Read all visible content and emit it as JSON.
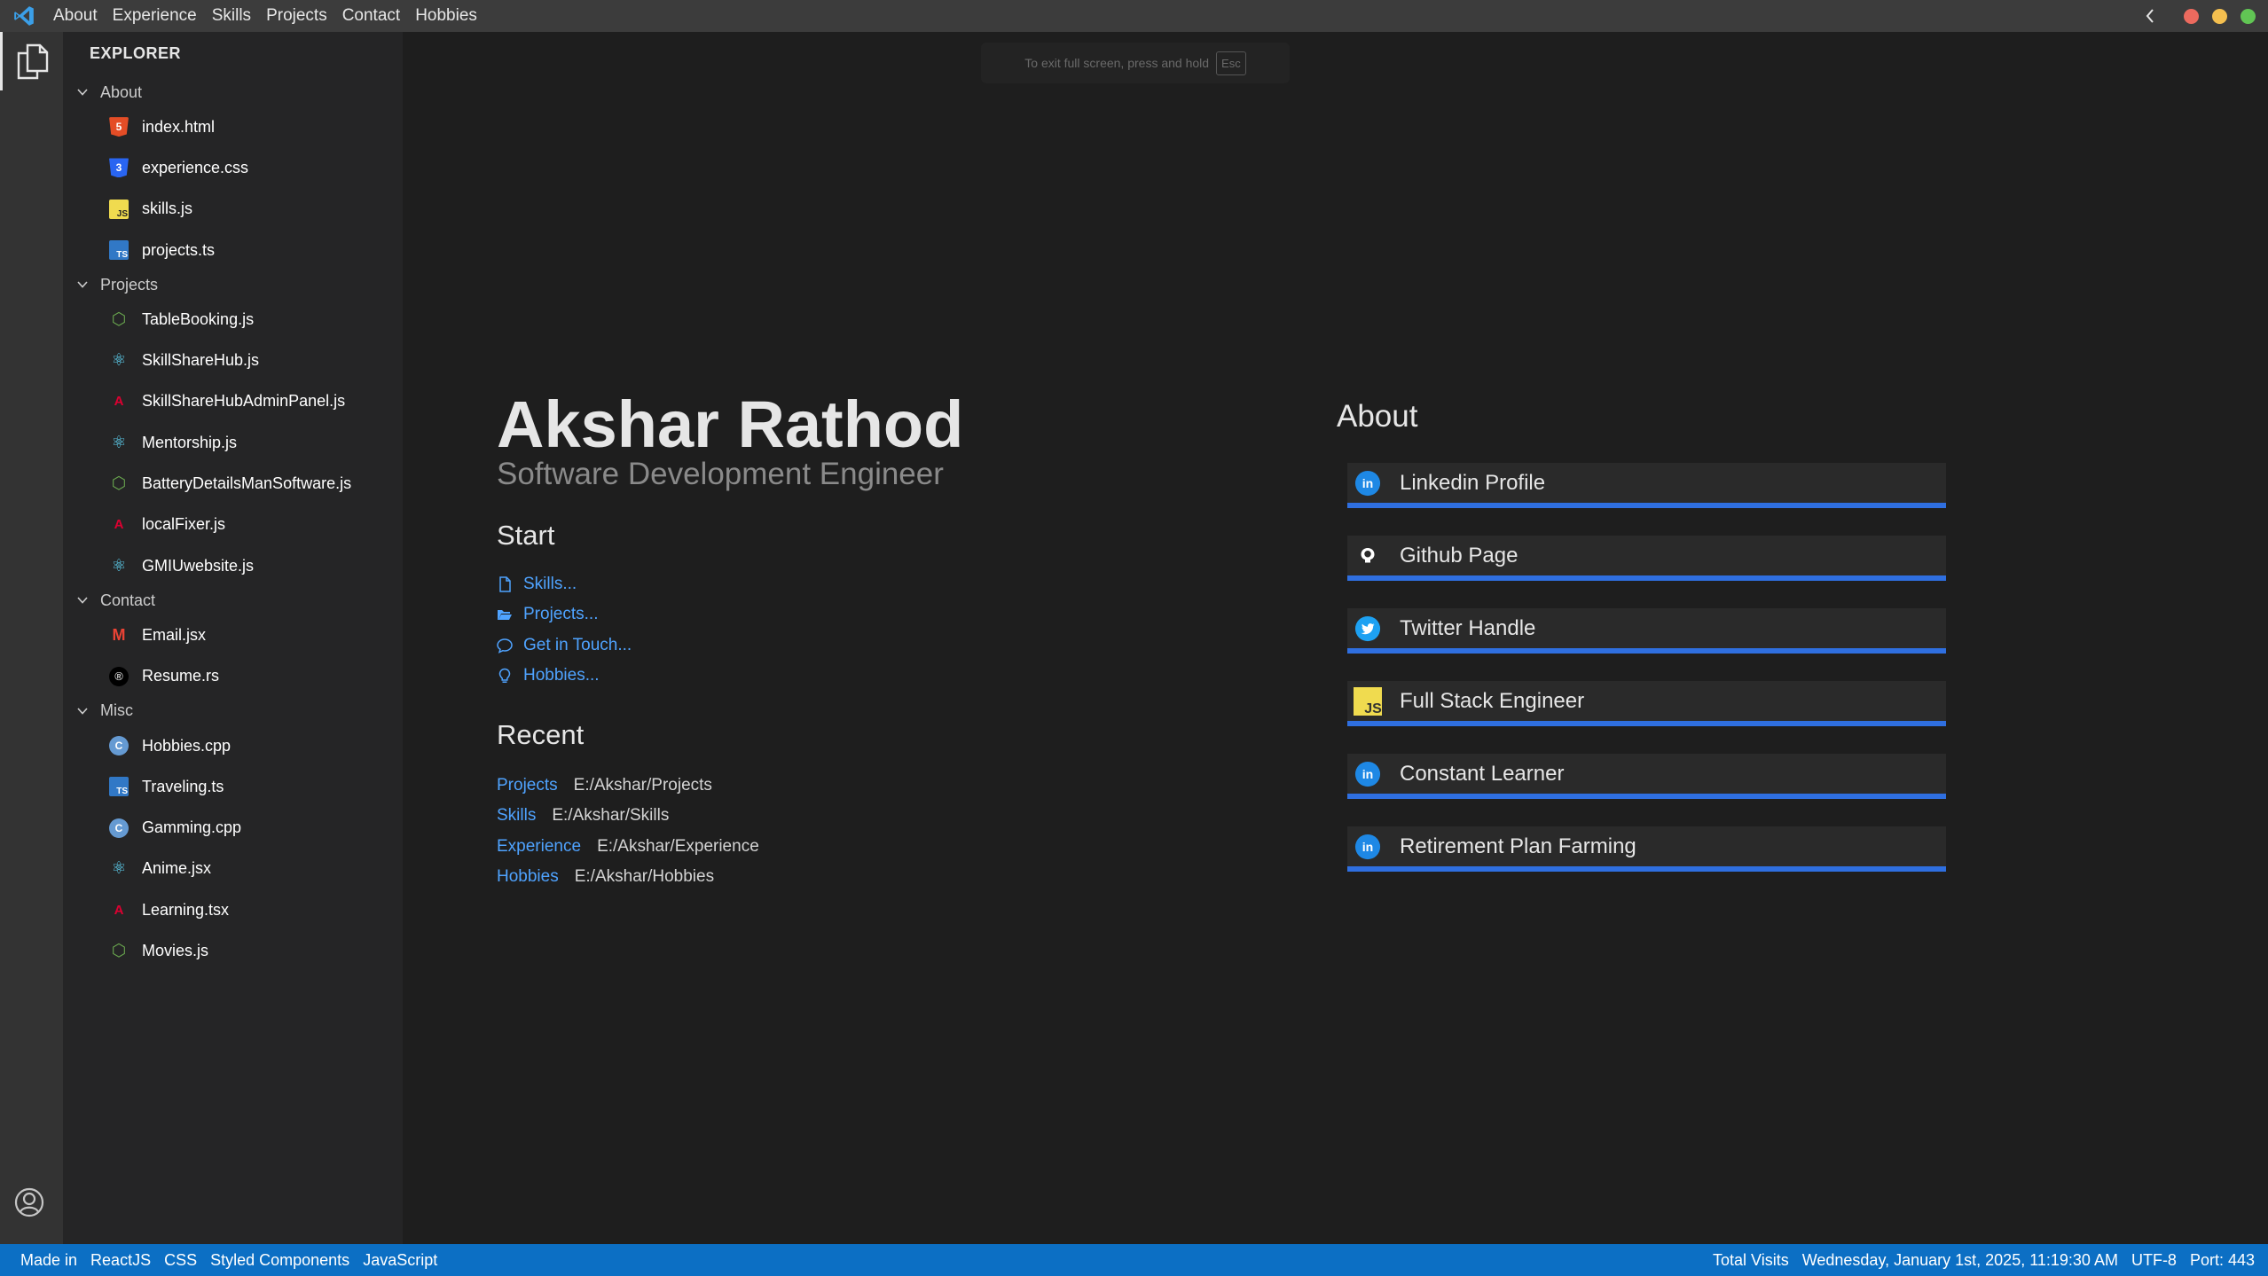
{
  "titlebar": {
    "menu": [
      "About",
      "Experience",
      "Skills",
      "Projects",
      "Contact",
      "Hobbies"
    ],
    "dots": [
      "#ec6a5e",
      "#f4bf4f",
      "#61c554"
    ]
  },
  "sidebar": {
    "title": "EXPLORER",
    "folders": [
      {
        "name": "About",
        "files": [
          {
            "name": "index.html",
            "icon": "html-icon",
            "color": "#e44d26",
            "glyph": "5"
          },
          {
            "name": "experience.css",
            "icon": "css-icon",
            "color": "#2965f1",
            "glyph": "3"
          },
          {
            "name": "skills.js",
            "icon": "js-icon",
            "color": "#f0db4f",
            "glyph": "JS"
          },
          {
            "name": "projects.ts",
            "icon": "ts-icon",
            "color": "#3178c6",
            "glyph": "TS"
          }
        ]
      },
      {
        "name": "Projects",
        "files": [
          {
            "name": "TableBooking.js",
            "icon": "nodejs-icon",
            "color": "#6aa84f",
            "glyph": "⬡"
          },
          {
            "name": "SkillShareHub.js",
            "icon": "react-icon",
            "color": "#61dafb",
            "glyph": "⚛"
          },
          {
            "name": "SkillShareHubAdminPanel.js",
            "icon": "angular-icon",
            "color": "#dd0031",
            "glyph": "A"
          },
          {
            "name": "Mentorship.js",
            "icon": "react-icon",
            "color": "#61dafb",
            "glyph": "⚛"
          },
          {
            "name": "BatteryDetailsManSoftware.js",
            "icon": "nodejs-icon",
            "color": "#6aa84f",
            "glyph": "⬡"
          },
          {
            "name": "localFixer.js",
            "icon": "angular-icon",
            "color": "#dd0031",
            "glyph": "A"
          },
          {
            "name": "GMIUwebsite.js",
            "icon": "react-icon",
            "color": "#61dafb",
            "glyph": "⚛"
          }
        ]
      },
      {
        "name": "Contact",
        "files": [
          {
            "name": "Email.jsx",
            "icon": "gmail-icon",
            "color": "#ea4335",
            "glyph": "M"
          },
          {
            "name": "Resume.rs",
            "icon": "rust-icon",
            "color": "#000000",
            "glyph": "®"
          }
        ]
      },
      {
        "name": "Misc",
        "files": [
          {
            "name": "Hobbies.cpp",
            "icon": "cpp-icon",
            "color": "#659ad2",
            "glyph": "C"
          },
          {
            "name": "Traveling.ts",
            "icon": "ts-icon",
            "color": "#3178c6",
            "glyph": "TS"
          },
          {
            "name": "Gamming.cpp",
            "icon": "cpp-icon",
            "color": "#659ad2",
            "glyph": "C"
          },
          {
            "name": "Anime.jsx",
            "icon": "react-icon",
            "color": "#61dafb",
            "glyph": "⚛"
          },
          {
            "name": "Learning.tsx",
            "icon": "angular-icon",
            "color": "#dd0031",
            "glyph": "A"
          },
          {
            "name": "Movies.js",
            "icon": "nodejs-icon",
            "color": "#6aa84f",
            "glyph": "⬡"
          }
        ]
      }
    ]
  },
  "editor": {
    "fullscreen_hint": "To exit full screen, press and hold",
    "fullscreen_key": "Esc",
    "name": "Akshar Rathod",
    "role": "Software Development Engineer",
    "start_heading": "Start",
    "start_items": [
      {
        "label": "Skills...",
        "icon": "file-icon"
      },
      {
        "label": "Projects...",
        "icon": "folder-open-icon"
      },
      {
        "label": "Get in Touch...",
        "icon": "comment-icon"
      },
      {
        "label": "Hobbies...",
        "icon": "lightbulb-icon"
      }
    ],
    "recent_heading": "Recent",
    "recent_items": [
      {
        "label": "Projects",
        "path": "E:/Akshar/Projects"
      },
      {
        "label": "Skills",
        "path": "E:/Akshar/Skills"
      },
      {
        "label": "Experience",
        "path": "E:/Akshar/Experience"
      },
      {
        "label": "Hobbies",
        "path": "E:/Akshar/Hobbies"
      }
    ],
    "about_heading": "About",
    "about_items": [
      {
        "label": "Linkedin Profile",
        "icon": "linkedin-icon"
      },
      {
        "label": "Github Page",
        "icon": "github-icon"
      },
      {
        "label": "Twitter Handle",
        "icon": "twitter-icon"
      },
      {
        "label": "Full Stack Engineer",
        "icon": "js-icon"
      },
      {
        "label": "Constant Learner",
        "icon": "linkedin-icon"
      },
      {
        "label": "Retirement Plan Farming",
        "icon": "linkedin-icon"
      }
    ]
  },
  "statusbar": {
    "left": [
      "Made in",
      "ReactJS",
      "CSS",
      "Styled Components",
      "JavaScript"
    ],
    "total_visits": "Total Visits",
    "datetime": "Wednesday, January 1st, 2025, 11:19:30 AM",
    "encoding": "UTF-8",
    "port": "Port: 443"
  },
  "colors": {
    "accent_blue": "#4fa3ff",
    "status_bar": "#0c6fc4",
    "about_underline": "#2f6fe0"
  }
}
